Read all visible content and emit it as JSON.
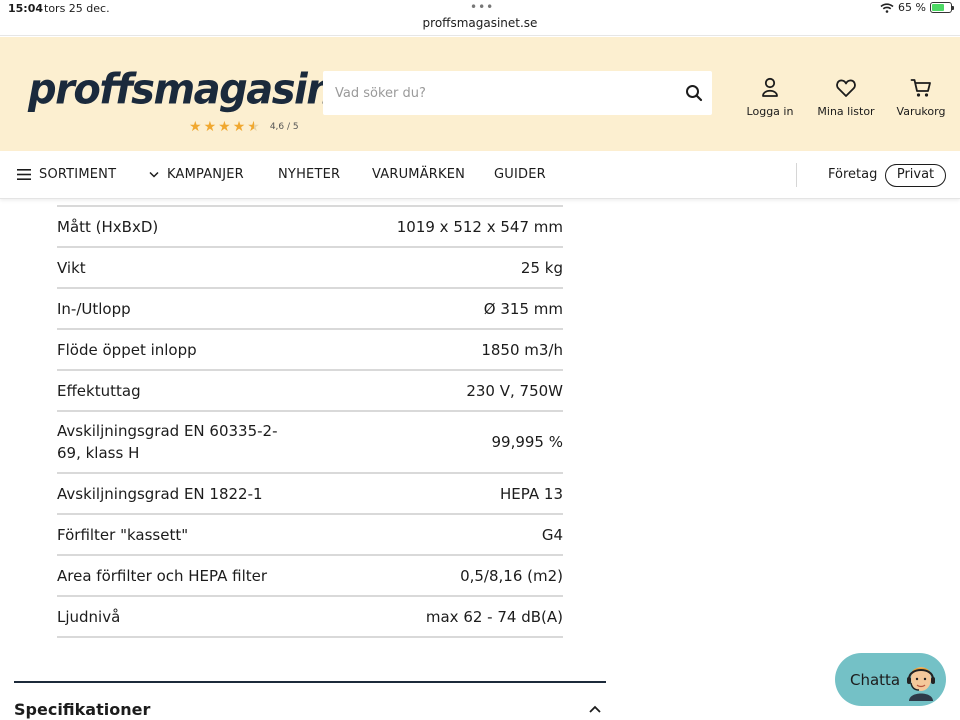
{
  "status_bar": {
    "time": "15:04",
    "date": "tors 25 dec.",
    "url": "proffsmagasinet.se",
    "battery": "65 %"
  },
  "header": {
    "logo": "proffsmagasinet",
    "rating_text": "4,6 / 5",
    "rating_value": 4.6,
    "search_placeholder": "Vad söker du?",
    "login_label": "Logga in",
    "lists_label": "Mina listor",
    "cart_label": "Varukorg",
    "background_color": "#fcefd0"
  },
  "nav": {
    "sortiment": "SORTIMENT",
    "kampanjer": "KAMPANJER",
    "nyheter": "NYHETER",
    "varumarken": "VARUMÄRKEN",
    "guider": "GUIDER",
    "foretag": "Företag",
    "privat": "Privat"
  },
  "specs": {
    "rows": [
      {
        "label": "Mått (HxBxD)",
        "value": "1019 x 512 x 547 mm"
      },
      {
        "label": "Vikt",
        "value": "25 kg"
      },
      {
        "label": "In-/Utlopp",
        "value": "Ø 315 mm"
      },
      {
        "label": "Flöde öppet inlopp",
        "value": "1850 m3/h"
      },
      {
        "label": "Effektuttag",
        "value": "230 V, 750W"
      },
      {
        "label": "Avskiljningsgrad EN 60335-2-69, klass H",
        "value": "99,995 %"
      },
      {
        "label": "Avskiljningsgrad EN 1822-1",
        "value": "HEPA 13"
      },
      {
        "label": "Förfilter \"kassett\"",
        "value": "G4"
      },
      {
        "label": "Area förfilter och HEPA filter",
        "value": "0,5/8,16 (m2)"
      },
      {
        "label": "Ljudnivå",
        "value": "max 62 - 74 dB(A)"
      }
    ]
  },
  "section": {
    "title": "Specifikationer"
  },
  "chat": {
    "label": "Chatta",
    "color": "#74c1c6"
  }
}
